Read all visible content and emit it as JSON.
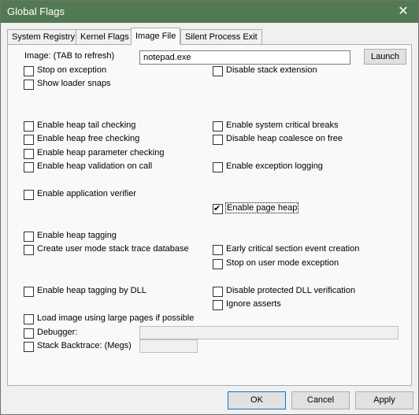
{
  "window": {
    "title": "Global Flags",
    "close_glyph": "✕"
  },
  "tabs": [
    {
      "label": "System Registry"
    },
    {
      "label": "Kernel Flags"
    },
    {
      "label": "Image File"
    },
    {
      "label": "Silent Process Exit"
    }
  ],
  "image": {
    "label": "Image: (TAB to refresh)",
    "value": "notepad.exe",
    "launch_label": "Launch"
  },
  "checks": {
    "stop_on_exception": {
      "label": "Stop on exception",
      "checked": false
    },
    "disable_stack_extension": {
      "label": "Disable stack extension",
      "checked": false
    },
    "show_loader_snaps": {
      "label": "Show loader snaps",
      "checked": false
    },
    "heap_tail": {
      "label": "Enable heap tail checking",
      "checked": false
    },
    "system_critical_breaks": {
      "label": "Enable system critical breaks",
      "checked": false
    },
    "heap_free": {
      "label": "Enable heap free checking",
      "checked": false
    },
    "disable_heap_coalesce": {
      "label": "Disable heap coalesce on free",
      "checked": false
    },
    "heap_param": {
      "label": "Enable heap parameter checking",
      "checked": false
    },
    "heap_validation": {
      "label": "Enable heap validation on call",
      "checked": false
    },
    "exception_logging": {
      "label": "Enable exception logging",
      "checked": false
    },
    "app_verifier": {
      "label": "Enable application verifier",
      "checked": false
    },
    "page_heap": {
      "label": "Enable page heap",
      "checked": true
    },
    "heap_tagging": {
      "label": "Enable heap tagging",
      "checked": false
    },
    "stack_trace_db": {
      "label": "Create user mode stack trace database",
      "checked": false
    },
    "early_critical_section": {
      "label": "Early critical section event creation",
      "checked": false
    },
    "stop_user_mode_exception": {
      "label": "Stop on user mode exception",
      "checked": false
    },
    "heap_tagging_dll": {
      "label": "Enable heap tagging by DLL",
      "checked": false
    },
    "disable_protected_dll": {
      "label": "Disable protected DLL verification",
      "checked": false
    },
    "ignore_asserts": {
      "label": "Ignore asserts",
      "checked": false
    },
    "large_pages": {
      "label": "Load image using large pages if possible",
      "checked": false
    },
    "debugger": {
      "label": "Debugger:",
      "checked": false
    },
    "stack_backtrace": {
      "label": "Stack Backtrace: (Megs)",
      "checked": false
    }
  },
  "buttons": {
    "ok": "OK",
    "cancel": "Cancel",
    "apply": "Apply"
  }
}
